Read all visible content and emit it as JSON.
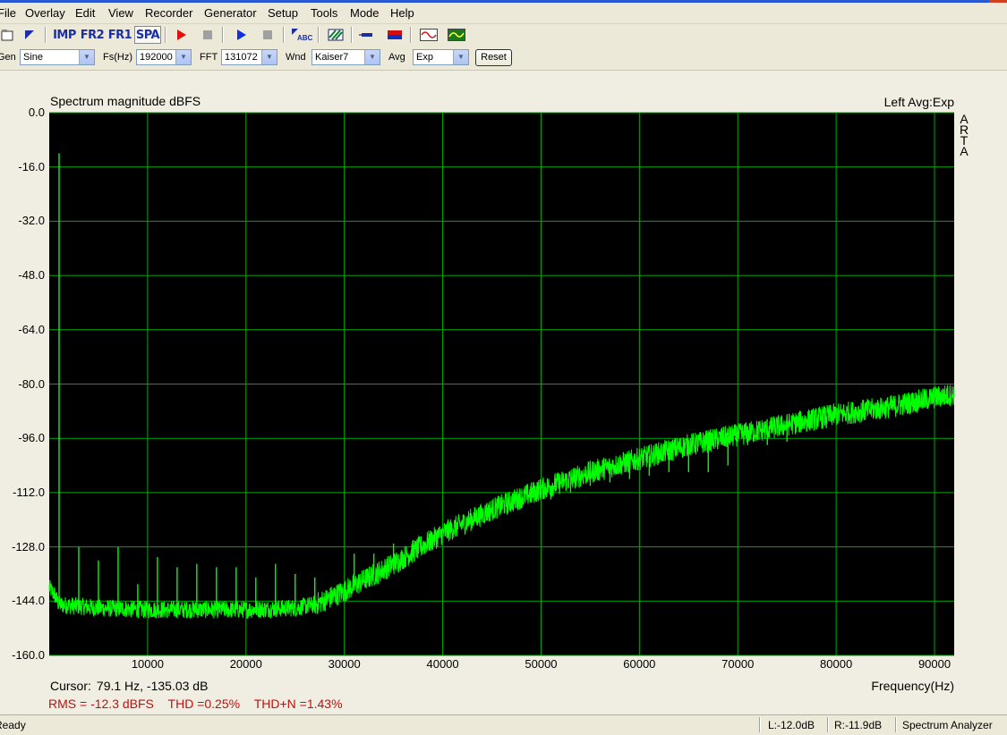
{
  "menu": [
    "File",
    "Overlay",
    "Edit",
    "View",
    "Recorder",
    "Generator",
    "Setup",
    "Tools",
    "Mode",
    "Help"
  ],
  "toolbar": {
    "imp_label": "IMP",
    "fr2_label": "FR2",
    "fr1_label": "FR1",
    "spa_label": "SPA",
    "abc_label": "ABC"
  },
  "generator_bar": {
    "gen_label": "Gen",
    "gen_value": "Sine",
    "fs_label": "Fs(Hz)",
    "fs_value": "192000",
    "fft_label": "FFT",
    "fft_value": "131072",
    "wnd_label": "Wnd",
    "wnd_value": "Kaiser7",
    "avg_label": "Avg",
    "avg_value": "Exp",
    "reset_label": "Reset"
  },
  "chart_header": {
    "title": "Spectrum magnitude dBFS",
    "right": "Left  Avg:Exp",
    "logo_letters": [
      "A",
      "R",
      "T",
      "A"
    ]
  },
  "readout": {
    "cursor_label": "Cursor:",
    "cursor_value": "79.1 Hz, -135.03 dB",
    "x_axis_label": "Frequency(Hz)",
    "rms": "RMS =  -12.3 dBFS",
    "thd": "THD =0.25%",
    "thdn": "THD+N =1.43%"
  },
  "status": {
    "left": "Ready",
    "level_l": "L:-12.0dB",
    "level_r": "R:-11.9dB",
    "mode": "Spectrum Analyzer"
  },
  "colors": {
    "plot_bg": "#000000",
    "grid": "#00aa00",
    "trace": "#00ff00",
    "measure_text": "#c01010"
  },
  "chart_data": {
    "type": "line",
    "title": "Spectrum magnitude dBFS",
    "xlabel": "Frequency(Hz)",
    "ylabel": "",
    "xlim": [
      0,
      92000
    ],
    "ylim": [
      -160,
      0
    ],
    "x_ticks": [
      10000,
      20000,
      30000,
      40000,
      50000,
      60000,
      70000,
      80000,
      90000
    ],
    "y_ticks": [
      "0.0",
      "-16.0",
      "-32.0",
      "-48.0",
      "-64.0",
      "-80.0",
      "-96.0",
      "-112.0",
      "-128.0",
      "-144.0",
      "-160.0"
    ],
    "grid": true,
    "series": [
      {
        "noise_floor": {
          "x": [
            0,
            500,
            1000,
            5000,
            10000,
            15000,
            20000,
            25000,
            27000,
            30000,
            35000,
            40000,
            45000,
            50000,
            55000,
            60000,
            65000,
            70000,
            75000,
            80000,
            85000,
            90000,
            92000
          ],
          "y": [
            -140,
            -142,
            -145,
            -146,
            -146.5,
            -146.5,
            -146.5,
            -146,
            -145,
            -141,
            -133,
            -124,
            -117,
            -111,
            -106,
            -102,
            -98,
            -95,
            -92,
            -89,
            -87,
            -84,
            -83
          ]
        },
        "peaks": {
          "x": [
            1000,
            3000,
            5000,
            7000,
            9000,
            11000,
            13000,
            15000,
            17000,
            19000,
            21000,
            23000,
            25000,
            27000,
            29000,
            31000,
            33000,
            35000,
            37000,
            39000,
            41000,
            43000,
            45000,
            47000,
            49000,
            51000,
            53000,
            55000,
            57000,
            59000,
            61000,
            63000,
            65000,
            67000,
            69000,
            71000,
            73000,
            75000,
            77000,
            79000,
            81000,
            83000,
            85000,
            87000,
            89000,
            91000
          ],
          "y": [
            -12,
            -128,
            -132,
            -128,
            -139,
            -131,
            -134,
            -133,
            -134,
            -134,
            -137,
            -133,
            -136,
            -137,
            -140,
            -130,
            -130,
            -127,
            -126,
            -125,
            -123,
            -120,
            -118,
            -116,
            -115,
            -114,
            -112,
            -110,
            -109,
            -108,
            -107,
            -106,
            -106,
            -106,
            -104,
            -98,
            -98,
            -97,
            -94,
            -93,
            -91,
            -88,
            -87,
            -86,
            -87,
            -86
          ]
        }
      }
    ]
  }
}
